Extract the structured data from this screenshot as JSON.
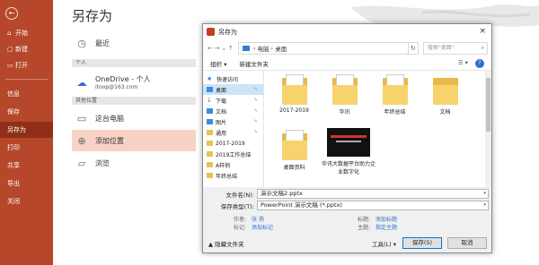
{
  "nav": {
    "back": "←",
    "items": [
      {
        "label": "开始"
      },
      {
        "label": "新建"
      },
      {
        "label": "打开"
      },
      {
        "label": "信息"
      },
      {
        "label": "保存"
      },
      {
        "label": "另存为"
      },
      {
        "label": "打印"
      },
      {
        "label": "共享"
      },
      {
        "label": "导出"
      },
      {
        "label": "关闭"
      }
    ]
  },
  "backstage": {
    "title": "另存为",
    "recent": "最近",
    "personal_head": "个人",
    "onedrive_label": "OneDrive - 个人",
    "onedrive_email": "itoop@163.com",
    "other_head": "其他位置",
    "this_pc": "这台电脑",
    "add_place": "添加位置",
    "browse": "浏览"
  },
  "dialog": {
    "title": "另存为",
    "close": "×",
    "path": [
      "电脑",
      "桌面"
    ],
    "search_placeholder": "搜索\"桌面\"",
    "organize": "组织 ▾",
    "new_folder": "新建文件夹",
    "tree": [
      {
        "label": "快速访问",
        "icon": "star"
      },
      {
        "label": "桌面",
        "icon": "blue",
        "pinned": true,
        "selected": true
      },
      {
        "label": "下载",
        "icon": "download",
        "pinned": true
      },
      {
        "label": "文档",
        "icon": "blue",
        "pinned": true
      },
      {
        "label": "图片",
        "icon": "blue",
        "pinned": true
      },
      {
        "label": "通用",
        "icon": "yellow",
        "pinned": true
      },
      {
        "label": "2017-2019",
        "icon": "yellow"
      },
      {
        "label": "2019工作总结",
        "icon": "yellow"
      },
      {
        "label": "A样例",
        "icon": "yellow"
      },
      {
        "label": "年终总结",
        "icon": "yellow"
      }
    ],
    "files": [
      {
        "name": "2017-2019",
        "kind": "folder"
      },
      {
        "name": "华讯",
        "kind": "folder"
      },
      {
        "name": "年终总结",
        "kind": "folder"
      },
      {
        "name": "文档",
        "kind": "folder"
      },
      {
        "name": "桌面资料",
        "kind": "folder"
      },
      {
        "name": "华讯大数据平台助力企业数字化",
        "kind": "video"
      }
    ],
    "filename_label": "文件名(N):",
    "filename_value": "演示文稿2.pptx",
    "savetype_label": "保存类型(T):",
    "savetype_value": "PowerPoint 演示文稿 (*.pptx)",
    "author_label": "作者:",
    "author_value": "张 扬",
    "tags_label": "标记:",
    "tags_value": "添加标记",
    "title_label": "标题:",
    "title_value": "添加标题",
    "subject_label": "主题:",
    "subject_value": "指定主题",
    "hide_folders": "▲ 隐藏文件夹",
    "tools": "工具(L) ▾",
    "save_button": "保存(S)",
    "cancel_button": "取消"
  }
}
